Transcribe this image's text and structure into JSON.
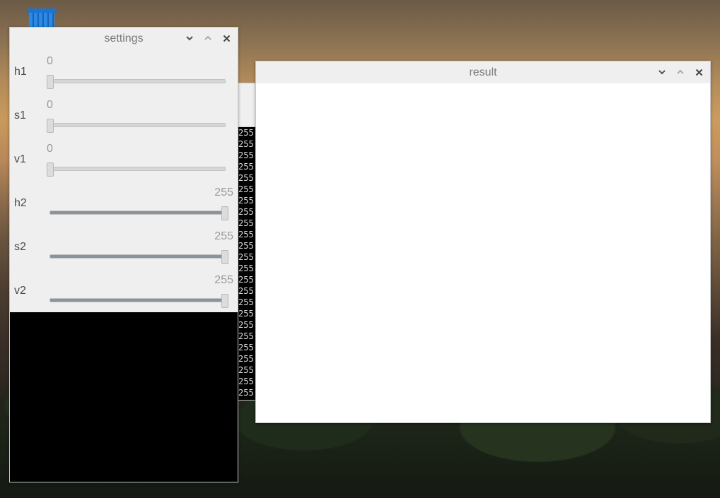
{
  "desktop": {
    "icons": [
      {
        "name": "trash-icon"
      }
    ]
  },
  "terminal": {
    "lines": [
      "255)",
      "255)",
      "255",
      "255",
      "255",
      "255",
      "255",
      "255",
      "255",
      "255",
      "255",
      "255",
      "255",
      "255",
      "255",
      "255",
      "255",
      "255",
      "255",
      "255",
      "255",
      "255)",
      "255)",
      "255)"
    ]
  },
  "settings": {
    "title": "settings",
    "controls": {
      "minimize": "chevron-down-icon",
      "maximize": "chevron-up-icon",
      "close": "close-icon"
    },
    "sliders": [
      {
        "label": "h1",
        "value": "0",
        "fraction": 0
      },
      {
        "label": "s1",
        "value": "0",
        "fraction": 0
      },
      {
        "label": "v1",
        "value": "0",
        "fraction": 0
      },
      {
        "label": "h2",
        "value": "255",
        "fraction": 1
      },
      {
        "label": "s2",
        "value": "255",
        "fraction": 1
      },
      {
        "label": "v2",
        "value": "255",
        "fraction": 1
      }
    ]
  },
  "result": {
    "title": "result",
    "controls": {
      "minimize": "chevron-down-icon",
      "maximize": "chevron-up-icon",
      "close": "close-icon"
    }
  },
  "colors": {
    "slider_fill": "#8a929a",
    "titlebar": "#efefef",
    "canvas_black": "#000000",
    "canvas_white": "#ffffff"
  }
}
